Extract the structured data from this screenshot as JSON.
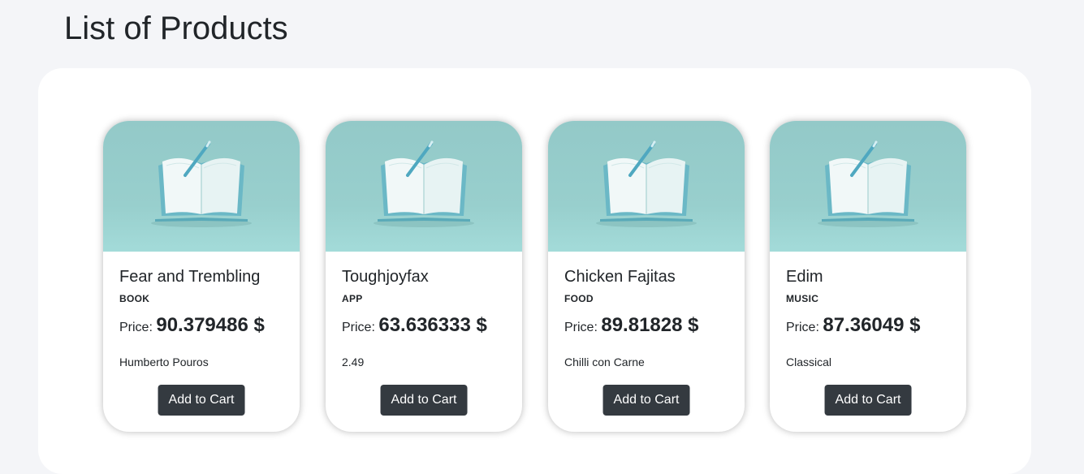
{
  "page": {
    "title": "List of Products",
    "background": "#f4f5f8",
    "button_color": "#343a40"
  },
  "products": [
    {
      "name": "Fear and Trembling",
      "category": "BOOK",
      "price_label": "Price:",
      "price_value": "90.379486 $",
      "detail": "Humberto Pouros",
      "button_label": "Add to Cart",
      "image_icon": "open-book-with-pen"
    },
    {
      "name": "Toughjoyfax",
      "category": "APP",
      "price_label": "Price:",
      "price_value": "63.636333 $",
      "detail": "2.49",
      "button_label": "Add to Cart",
      "image_icon": "open-book-with-pen"
    },
    {
      "name": "Chicken Fajitas",
      "category": "FOOD",
      "price_label": "Price:",
      "price_value": "89.81828 $",
      "detail": "Chilli con Carne",
      "button_label": "Add to Cart",
      "image_icon": "open-book-with-pen"
    },
    {
      "name": "Edim",
      "category": "MUSIC",
      "price_label": "Price:",
      "price_value": "87.36049 $",
      "detail": "Classical",
      "button_label": "Add to Cart",
      "image_icon": "open-book-with-pen"
    }
  ]
}
